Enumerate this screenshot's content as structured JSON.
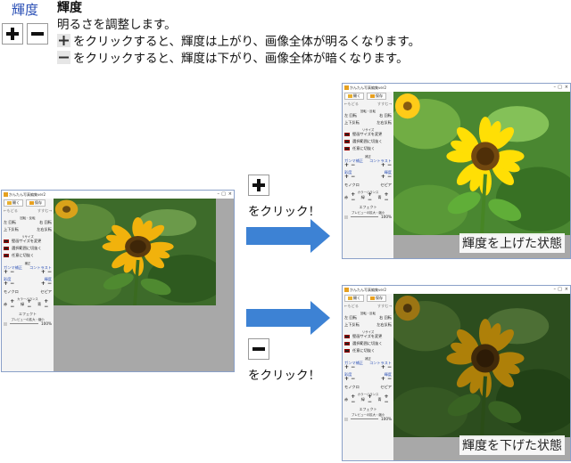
{
  "header": {
    "button_label": "輝度",
    "title": "輝度",
    "line1": "明るさを調整します。",
    "line2": "をクリックすると、輝度は上がり、画像全体が明るくなります。",
    "line3": "をクリックすると、輝度は下がり、画像全体が暗くなります。"
  },
  "middle": {
    "click_plus": "をクリック！",
    "click_minus": "をクリック！"
  },
  "window": {
    "title": "かんたん写真編集ver2",
    "open_label": "開く",
    "save_label": "保存",
    "undo_label": "←もどる",
    "redo_label": "すすむ→",
    "section_rotate": "回転・反転",
    "rotate_left": "左 回転",
    "rotate_right": "右 回転",
    "flip_vertical": "上下反転",
    "flip_horizontal": "左右反転",
    "section_resize": "リサイズ",
    "resize_wallpaper": "壁画サイズを変更",
    "resize_crop": "選択範囲に切抜く",
    "resize_free": "任意に切抜く",
    "section_adjust": "補正",
    "gamma_label": "ガンマ補正",
    "contrast_label": "コントラスト",
    "brightness_label": "彩度",
    "hue_label": "輝度",
    "mono_label": "モノクロ",
    "sepia_label": "セピア",
    "section_color": "カラーバランス",
    "color_red": "赤",
    "color_green": "緑",
    "color_blue": "青",
    "effect_label": "エフェクト",
    "preview_label": "プレビューの拡大・縮小",
    "zoom_value": "100%"
  },
  "results": {
    "up_label": "輝度を上げた状態",
    "down_label": "輝度を下げた状態"
  },
  "colors": {
    "arrow": "#3d82d4",
    "header_blue": "#2a4fb5",
    "viewer_gray": "#a8a8a8",
    "petal": "#f1b20c",
    "leaf": "#3f7a2a"
  },
  "icons": [
    "plus-icon",
    "minus-icon",
    "folder-icon",
    "save-icon",
    "arrow-right-icon"
  ]
}
